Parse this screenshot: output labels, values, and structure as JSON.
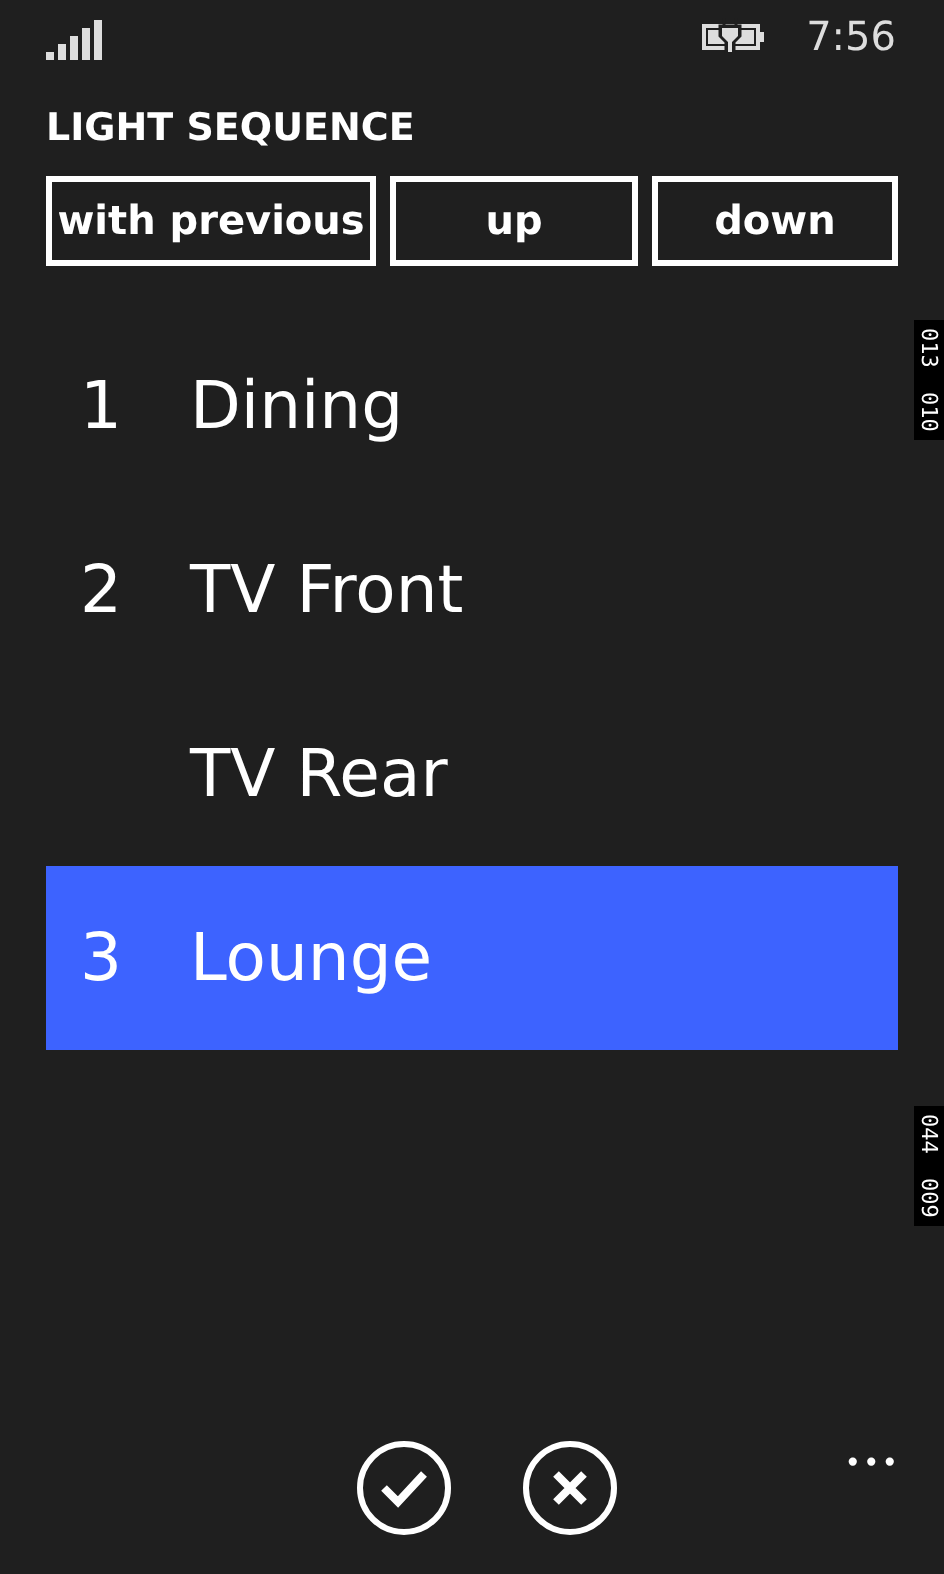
{
  "status_bar": {
    "time": "7:56"
  },
  "title": "LIGHT SEQUENCE",
  "buttons": [
    "with previous",
    "up",
    "down"
  ],
  "items": [
    {
      "number": "1",
      "name": "Dining",
      "selected": false
    },
    {
      "number": "2",
      "name": "TV Front",
      "selected": false
    },
    {
      "name": "TV Rear",
      "selected": false
    },
    {
      "number": "3",
      "name": "Lounge",
      "selected": true
    }
  ],
  "side_counters": [
    [
      "013",
      "010"
    ],
    [
      "044",
      "009"
    ]
  ],
  "app_bar": {
    "more": "•••"
  }
}
